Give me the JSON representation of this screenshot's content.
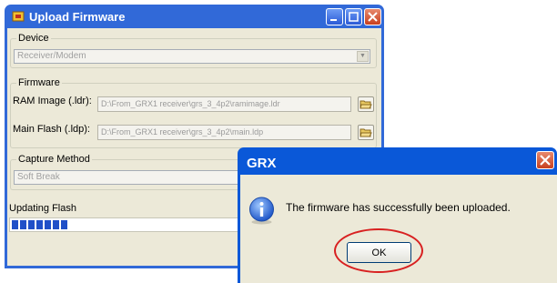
{
  "upload_window": {
    "title": "Upload Firmware",
    "device": {
      "group_label": "Device",
      "selected_value": "Receiver/Modem"
    },
    "firmware": {
      "group_label": "Firmware",
      "ram_image_label": "RAM Image (.ldr):",
      "ram_image_path": "D:\\From_GRX1 receiver\\grs_3_4p2\\ramimage.ldr",
      "main_flash_label": "Main Flash (.ldp):",
      "main_flash_path": "D:\\From_GRX1 receiver\\grs_3_4p2\\main.ldp"
    },
    "capture_method": {
      "group_label": "Capture Method",
      "selected_value": "Soft Break"
    },
    "status_text": "Updating Flash",
    "progress_segments": 7
  },
  "grx_dialog": {
    "title": "GRX",
    "message": "The firmware has successfully been uploaded.",
    "ok_label": "OK"
  },
  "colors": {
    "title_bar": "#3169d8",
    "dialog_title_bar": "#0a58d8",
    "window_face": "#ece9d8",
    "progress_fill": "#2050c8",
    "highlight_circle": "#d82020"
  }
}
